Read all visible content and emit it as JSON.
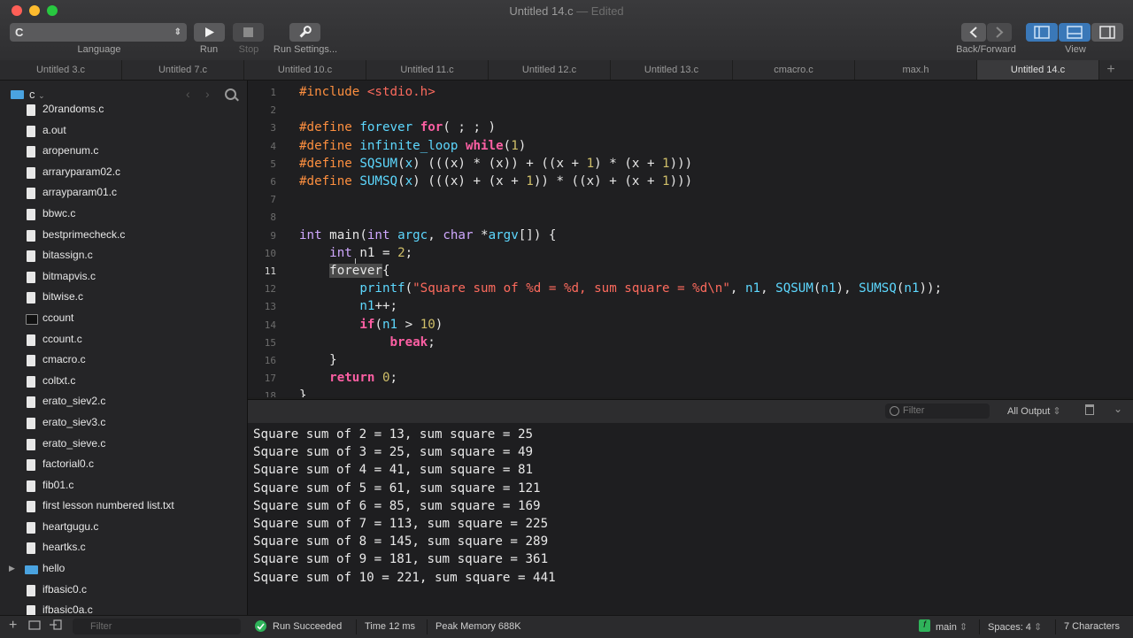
{
  "window": {
    "title": "Untitled 14.c",
    "edited_suffix": " — Edited"
  },
  "toolbar": {
    "language_value": "C",
    "language_label": "Language",
    "run_label": "Run",
    "stop_label": "Stop",
    "run_settings_label": "Run Settings...",
    "back_forward_label": "Back/Forward",
    "view_label": "View"
  },
  "tabs": [
    {
      "label": "Untitled 3.c",
      "active": false
    },
    {
      "label": "Untitled 7.c",
      "active": false
    },
    {
      "label": "Untitled 10.c",
      "active": false
    },
    {
      "label": "Untitled 11.c",
      "active": false
    },
    {
      "label": "Untitled 12.c",
      "active": false
    },
    {
      "label": "Untitled 13.c",
      "active": false
    },
    {
      "label": "cmacro.c",
      "active": false
    },
    {
      "label": "max.h",
      "active": false
    },
    {
      "label": "Untitled 14.c",
      "active": true
    }
  ],
  "tab_add_label": "+",
  "sidebar": {
    "folder": "c",
    "files": [
      {
        "name": "20randoms.c",
        "kind": "file"
      },
      {
        "name": "a.out",
        "kind": "file"
      },
      {
        "name": "aropenum.c",
        "kind": "file"
      },
      {
        "name": "arraryparam02.c",
        "kind": "file"
      },
      {
        "name": "arrayparam01.c",
        "kind": "file"
      },
      {
        "name": "bbwc.c",
        "kind": "file"
      },
      {
        "name": "bestprimecheck.c",
        "kind": "file"
      },
      {
        "name": "bitassign.c",
        "kind": "file"
      },
      {
        "name": "bitmapvis.c",
        "kind": "file"
      },
      {
        "name": "bitwise.c",
        "kind": "file"
      },
      {
        "name": "ccount",
        "kind": "exec"
      },
      {
        "name": "ccount.c",
        "kind": "file"
      },
      {
        "name": "cmacro.c",
        "kind": "file"
      },
      {
        "name": "coltxt.c",
        "kind": "file"
      },
      {
        "name": "erato_siev2.c",
        "kind": "file"
      },
      {
        "name": "erato_siev3.c",
        "kind": "file"
      },
      {
        "name": "erato_sieve.c",
        "kind": "file"
      },
      {
        "name": "factorial0.c",
        "kind": "file"
      },
      {
        "name": "fib01.c",
        "kind": "file"
      },
      {
        "name": "first lesson numbered list.txt",
        "kind": "file"
      },
      {
        "name": "heartgugu.c",
        "kind": "file"
      },
      {
        "name": "heartks.c",
        "kind": "file"
      },
      {
        "name": "hello",
        "kind": "folder"
      },
      {
        "name": "ifbasic0.c",
        "kind": "file"
      },
      {
        "name": "ifbasic0a.c",
        "kind": "file"
      }
    ],
    "filter_placeholder": "Filter"
  },
  "editor": {
    "current_line": 11,
    "lines": [
      [
        [
          "pp",
          "#include "
        ],
        [
          "str",
          "<stdio.h>"
        ]
      ],
      [],
      [
        [
          "pp",
          "#define "
        ],
        [
          "mc",
          "forever "
        ],
        [
          "kw",
          "for"
        ],
        [
          "t",
          "( ; ; )"
        ]
      ],
      [
        [
          "pp",
          "#define "
        ],
        [
          "mc",
          "infinite_loop "
        ],
        [
          "kw",
          "while"
        ],
        [
          "t",
          "("
        ],
        [
          "num",
          "1"
        ],
        [
          "t",
          ")"
        ]
      ],
      [
        [
          "pp",
          "#define "
        ],
        [
          "mc",
          "SQSUM"
        ],
        [
          "t",
          "("
        ],
        [
          "mc",
          "x"
        ],
        [
          "t",
          ") (((x) * (x)) + ((x + "
        ],
        [
          "num",
          "1"
        ],
        [
          "t",
          ") * (x + "
        ],
        [
          "num",
          "1"
        ],
        [
          "t",
          ")))"
        ]
      ],
      [
        [
          "pp",
          "#define "
        ],
        [
          "mc",
          "SUMSQ"
        ],
        [
          "t",
          "("
        ],
        [
          "mc",
          "x"
        ],
        [
          "t",
          ") (((x) + (x + "
        ],
        [
          "num",
          "1"
        ],
        [
          "t",
          ")) * ((x) + (x + "
        ],
        [
          "num",
          "1"
        ],
        [
          "t",
          ")))"
        ]
      ],
      [],
      [],
      [
        [
          "typ",
          "int "
        ],
        [
          "t",
          "main("
        ],
        [
          "typ",
          "int "
        ],
        [
          "mc",
          "argc"
        ],
        [
          "t",
          ", "
        ],
        [
          "typ",
          "char "
        ],
        [
          "t",
          "*"
        ],
        [
          "mc",
          "argv"
        ],
        [
          "t",
          "[]) {"
        ]
      ],
      [
        [
          "t",
          "    "
        ],
        [
          "typ",
          "int "
        ],
        [
          "t",
          "n1 = "
        ],
        [
          "num",
          "2"
        ],
        [
          "t",
          ";"
        ]
      ],
      [
        [
          "t",
          "    "
        ],
        [
          "sel",
          "forever"
        ],
        [
          "t",
          "{"
        ]
      ],
      [
        [
          "t",
          "        "
        ],
        [
          "mc",
          "printf"
        ],
        [
          "t",
          "("
        ],
        [
          "str",
          "\"Square sum of %d = %d, sum square = %d\\n\""
        ],
        [
          "t",
          ", "
        ],
        [
          "mc",
          "n1"
        ],
        [
          "t",
          ", "
        ],
        [
          "mc",
          "SQSUM"
        ],
        [
          "t",
          "("
        ],
        [
          "mc",
          "n1"
        ],
        [
          "t",
          "), "
        ],
        [
          "mc",
          "SUMSQ"
        ],
        [
          "t",
          "("
        ],
        [
          "mc",
          "n1"
        ],
        [
          "t",
          "));"
        ]
      ],
      [
        [
          "t",
          "        "
        ],
        [
          "mc",
          "n1"
        ],
        [
          "t",
          "++;"
        ]
      ],
      [
        [
          "t",
          "        "
        ],
        [
          "kw",
          "if"
        ],
        [
          "t",
          "("
        ],
        [
          "mc",
          "n1"
        ],
        [
          "t",
          " > "
        ],
        [
          "num",
          "10"
        ],
        [
          "t",
          ")"
        ]
      ],
      [
        [
          "t",
          "            "
        ],
        [
          "kw",
          "break"
        ],
        [
          "t",
          ";"
        ]
      ],
      [
        [
          "t",
          "    }"
        ]
      ],
      [
        [
          "t",
          "    "
        ],
        [
          "kw",
          "return "
        ],
        [
          "num",
          "0"
        ],
        [
          "t",
          ";"
        ]
      ],
      [
        [
          "t",
          "}"
        ]
      ]
    ]
  },
  "console_bar": {
    "filter_placeholder": "Filter",
    "output_select": "All Output"
  },
  "console_output": [
    "Square sum of 2 = 13, sum square = 25",
    "Square sum of 3 = 25, sum square = 49",
    "Square sum of 4 = 41, sum square = 81",
    "Square sum of 5 = 61, sum square = 121",
    "Square sum of 6 = 85, sum square = 169",
    "Square sum of 7 = 113, sum square = 225",
    "Square sum of 8 = 145, sum square = 289",
    "Square sum of 9 = 181, sum square = 361",
    "Square sum of 10 = 221, sum square = 441"
  ],
  "status": {
    "run_result": "Run Succeeded",
    "time": "Time 12 ms",
    "memory": "Peak Memory 688K",
    "function": "main",
    "function_badge": "f",
    "spaces": "Spaces: 4",
    "characters": "7 Characters"
  },
  "colors": {
    "keyword": "#fc5fa3",
    "preprocessor": "#fd8f3f",
    "identifier": "#5dd8ff",
    "string": "#fc6a5d",
    "number": "#d0bf69",
    "type": "#d0a8ff",
    "success": "#2fb35a",
    "accent": "#4aa3e0"
  }
}
